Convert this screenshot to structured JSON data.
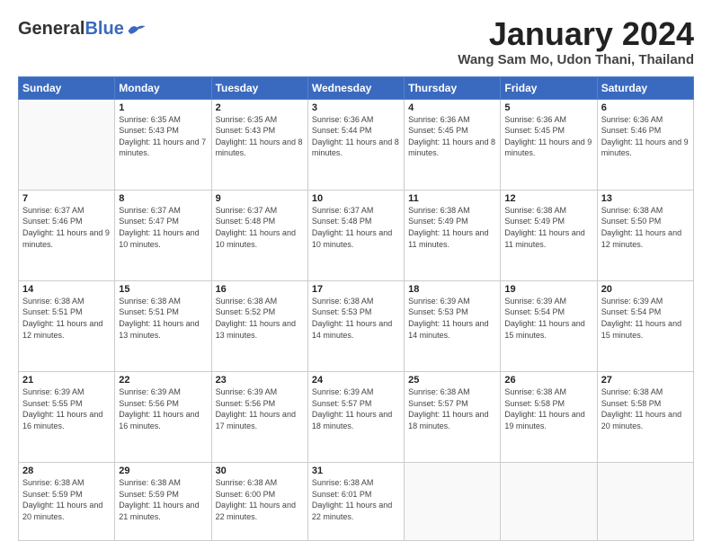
{
  "header": {
    "logo_general": "General",
    "logo_blue": "Blue",
    "month_title": "January 2024",
    "location": "Wang Sam Mo, Udon Thani, Thailand"
  },
  "weekdays": [
    "Sunday",
    "Monday",
    "Tuesday",
    "Wednesday",
    "Thursday",
    "Friday",
    "Saturday"
  ],
  "weeks": [
    [
      {
        "day": "",
        "sunrise": "",
        "sunset": "",
        "daylight": ""
      },
      {
        "day": "1",
        "sunrise": "Sunrise: 6:35 AM",
        "sunset": "Sunset: 5:43 PM",
        "daylight": "Daylight: 11 hours and 7 minutes."
      },
      {
        "day": "2",
        "sunrise": "Sunrise: 6:35 AM",
        "sunset": "Sunset: 5:43 PM",
        "daylight": "Daylight: 11 hours and 8 minutes."
      },
      {
        "day": "3",
        "sunrise": "Sunrise: 6:36 AM",
        "sunset": "Sunset: 5:44 PM",
        "daylight": "Daylight: 11 hours and 8 minutes."
      },
      {
        "day": "4",
        "sunrise": "Sunrise: 6:36 AM",
        "sunset": "Sunset: 5:45 PM",
        "daylight": "Daylight: 11 hours and 8 minutes."
      },
      {
        "day": "5",
        "sunrise": "Sunrise: 6:36 AM",
        "sunset": "Sunset: 5:45 PM",
        "daylight": "Daylight: 11 hours and 9 minutes."
      },
      {
        "day": "6",
        "sunrise": "Sunrise: 6:36 AM",
        "sunset": "Sunset: 5:46 PM",
        "daylight": "Daylight: 11 hours and 9 minutes."
      }
    ],
    [
      {
        "day": "7",
        "sunrise": "Sunrise: 6:37 AM",
        "sunset": "Sunset: 5:46 PM",
        "daylight": "Daylight: 11 hours and 9 minutes."
      },
      {
        "day": "8",
        "sunrise": "Sunrise: 6:37 AM",
        "sunset": "Sunset: 5:47 PM",
        "daylight": "Daylight: 11 hours and 10 minutes."
      },
      {
        "day": "9",
        "sunrise": "Sunrise: 6:37 AM",
        "sunset": "Sunset: 5:48 PM",
        "daylight": "Daylight: 11 hours and 10 minutes."
      },
      {
        "day": "10",
        "sunrise": "Sunrise: 6:37 AM",
        "sunset": "Sunset: 5:48 PM",
        "daylight": "Daylight: 11 hours and 10 minutes."
      },
      {
        "day": "11",
        "sunrise": "Sunrise: 6:38 AM",
        "sunset": "Sunset: 5:49 PM",
        "daylight": "Daylight: 11 hours and 11 minutes."
      },
      {
        "day": "12",
        "sunrise": "Sunrise: 6:38 AM",
        "sunset": "Sunset: 5:49 PM",
        "daylight": "Daylight: 11 hours and 11 minutes."
      },
      {
        "day": "13",
        "sunrise": "Sunrise: 6:38 AM",
        "sunset": "Sunset: 5:50 PM",
        "daylight": "Daylight: 11 hours and 12 minutes."
      }
    ],
    [
      {
        "day": "14",
        "sunrise": "Sunrise: 6:38 AM",
        "sunset": "Sunset: 5:51 PM",
        "daylight": "Daylight: 11 hours and 12 minutes."
      },
      {
        "day": "15",
        "sunrise": "Sunrise: 6:38 AM",
        "sunset": "Sunset: 5:51 PM",
        "daylight": "Daylight: 11 hours and 13 minutes."
      },
      {
        "day": "16",
        "sunrise": "Sunrise: 6:38 AM",
        "sunset": "Sunset: 5:52 PM",
        "daylight": "Daylight: 11 hours and 13 minutes."
      },
      {
        "day": "17",
        "sunrise": "Sunrise: 6:38 AM",
        "sunset": "Sunset: 5:53 PM",
        "daylight": "Daylight: 11 hours and 14 minutes."
      },
      {
        "day": "18",
        "sunrise": "Sunrise: 6:39 AM",
        "sunset": "Sunset: 5:53 PM",
        "daylight": "Daylight: 11 hours and 14 minutes."
      },
      {
        "day": "19",
        "sunrise": "Sunrise: 6:39 AM",
        "sunset": "Sunset: 5:54 PM",
        "daylight": "Daylight: 11 hours and 15 minutes."
      },
      {
        "day": "20",
        "sunrise": "Sunrise: 6:39 AM",
        "sunset": "Sunset: 5:54 PM",
        "daylight": "Daylight: 11 hours and 15 minutes."
      }
    ],
    [
      {
        "day": "21",
        "sunrise": "Sunrise: 6:39 AM",
        "sunset": "Sunset: 5:55 PM",
        "daylight": "Daylight: 11 hours and 16 minutes."
      },
      {
        "day": "22",
        "sunrise": "Sunrise: 6:39 AM",
        "sunset": "Sunset: 5:56 PM",
        "daylight": "Daylight: 11 hours and 16 minutes."
      },
      {
        "day": "23",
        "sunrise": "Sunrise: 6:39 AM",
        "sunset": "Sunset: 5:56 PM",
        "daylight": "Daylight: 11 hours and 17 minutes."
      },
      {
        "day": "24",
        "sunrise": "Sunrise: 6:39 AM",
        "sunset": "Sunset: 5:57 PM",
        "daylight": "Daylight: 11 hours and 18 minutes."
      },
      {
        "day": "25",
        "sunrise": "Sunrise: 6:38 AM",
        "sunset": "Sunset: 5:57 PM",
        "daylight": "Daylight: 11 hours and 18 minutes."
      },
      {
        "day": "26",
        "sunrise": "Sunrise: 6:38 AM",
        "sunset": "Sunset: 5:58 PM",
        "daylight": "Daylight: 11 hours and 19 minutes."
      },
      {
        "day": "27",
        "sunrise": "Sunrise: 6:38 AM",
        "sunset": "Sunset: 5:58 PM",
        "daylight": "Daylight: 11 hours and 20 minutes."
      }
    ],
    [
      {
        "day": "28",
        "sunrise": "Sunrise: 6:38 AM",
        "sunset": "Sunset: 5:59 PM",
        "daylight": "Daylight: 11 hours and 20 minutes."
      },
      {
        "day": "29",
        "sunrise": "Sunrise: 6:38 AM",
        "sunset": "Sunset: 5:59 PM",
        "daylight": "Daylight: 11 hours and 21 minutes."
      },
      {
        "day": "30",
        "sunrise": "Sunrise: 6:38 AM",
        "sunset": "Sunset: 6:00 PM",
        "daylight": "Daylight: 11 hours and 22 minutes."
      },
      {
        "day": "31",
        "sunrise": "Sunrise: 6:38 AM",
        "sunset": "Sunset: 6:01 PM",
        "daylight": "Daylight: 11 hours and 22 minutes."
      },
      {
        "day": "",
        "sunrise": "",
        "sunset": "",
        "daylight": ""
      },
      {
        "day": "",
        "sunrise": "",
        "sunset": "",
        "daylight": ""
      },
      {
        "day": "",
        "sunrise": "",
        "sunset": "",
        "daylight": ""
      }
    ]
  ]
}
